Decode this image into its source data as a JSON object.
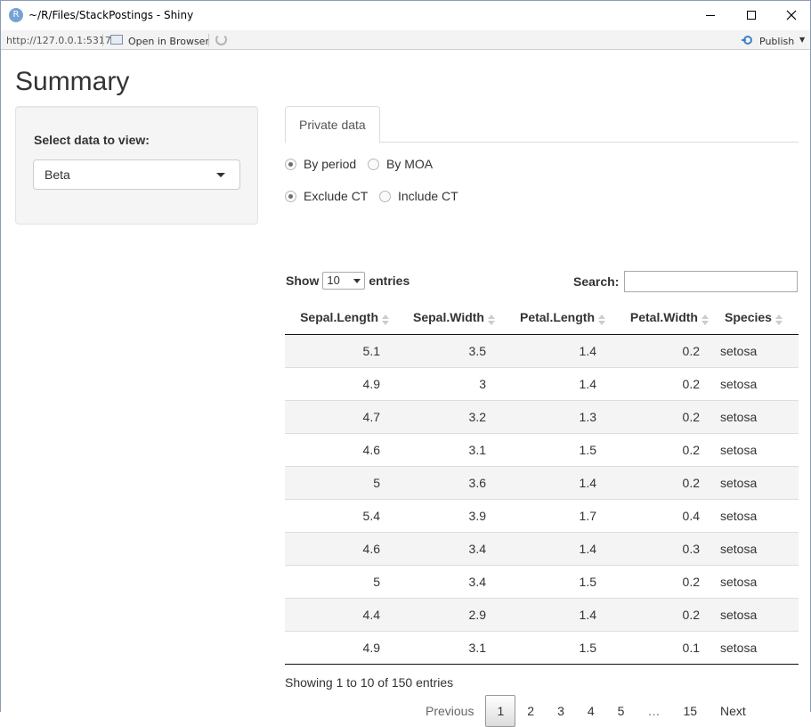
{
  "window": {
    "title": "~/R/Files/StackPostings - Shiny",
    "app_icon": "R",
    "url": "http://127.0.0.1:5317",
    "open_in_browser": "Open in Browser",
    "publish": "Publish"
  },
  "page": {
    "title": "Summary"
  },
  "sidebar": {
    "label": "Select data to view:",
    "selected": "Beta"
  },
  "tabs": [
    {
      "label": "Private data",
      "active": true
    }
  ],
  "radios": {
    "group1": [
      {
        "label": "By period",
        "checked": true
      },
      {
        "label": "By MOA",
        "checked": false
      }
    ],
    "group2": [
      {
        "label": "Exclude CT",
        "checked": true
      },
      {
        "label": "Include CT",
        "checked": false
      }
    ]
  },
  "table_controls": {
    "show": "Show",
    "page_length": "10",
    "entries": "entries",
    "search_label": "Search:",
    "search_value": ""
  },
  "table": {
    "columns": [
      "Sepal.Length",
      "Sepal.Width",
      "Petal.Length",
      "Petal.Width",
      "Species"
    ],
    "rows": [
      [
        "5.1",
        "3.5",
        "1.4",
        "0.2",
        "setosa"
      ],
      [
        "4.9",
        "3",
        "1.4",
        "0.2",
        "setosa"
      ],
      [
        "4.7",
        "3.2",
        "1.3",
        "0.2",
        "setosa"
      ],
      [
        "4.6",
        "3.1",
        "1.5",
        "0.2",
        "setosa"
      ],
      [
        "5",
        "3.6",
        "1.4",
        "0.2",
        "setosa"
      ],
      [
        "5.4",
        "3.9",
        "1.7",
        "0.4",
        "setosa"
      ],
      [
        "4.6",
        "3.4",
        "1.4",
        "0.3",
        "setosa"
      ],
      [
        "5",
        "3.4",
        "1.5",
        "0.2",
        "setosa"
      ],
      [
        "4.4",
        "2.9",
        "1.4",
        "0.2",
        "setosa"
      ],
      [
        "4.9",
        "3.1",
        "1.5",
        "0.1",
        "setosa"
      ]
    ]
  },
  "footer": {
    "info": "Showing 1 to 10 of 150 entries",
    "pages": [
      "Previous",
      "1",
      "2",
      "3",
      "4",
      "5",
      "…",
      "15",
      "Next"
    ],
    "current_page": "1"
  }
}
